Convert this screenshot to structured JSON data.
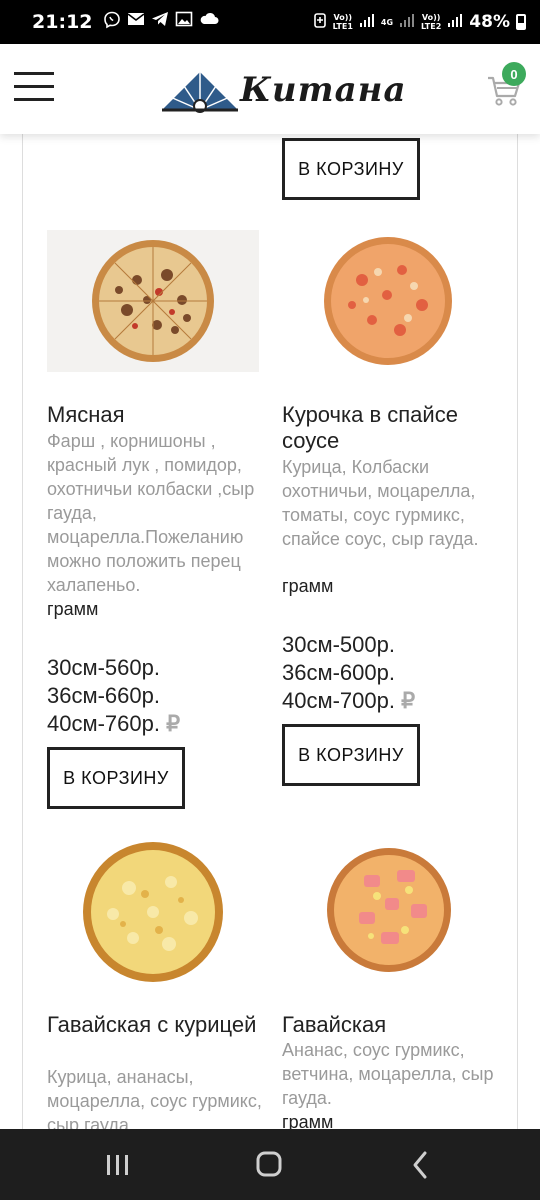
{
  "status": {
    "time": "12",
    "time_h": "21",
    "battery": "48%",
    "sim1_top": "Vo))",
    "sim1_bottom": "LTE1",
    "net": "4G",
    "sim2_top": "Vo))",
    "sim2_bottom": "LTE2",
    "battery_level": 0.48
  },
  "header": {
    "logo_text": "Китана",
    "cart_count": "0"
  },
  "cart_label": "В КОРЗИНУ",
  "products": [
    {
      "name": "Мясная",
      "description": "Фарш , корнишоны , красный лук , помидор, охотничьи колбаски ,сыр гауда, моцарелла.Пожеланию можно положить перец халапеньо.",
      "weight": "грамм",
      "prices": [
        "30см-560р.",
        "36см-660р.",
        "40см-760р."
      ],
      "currency": "₽"
    },
    {
      "name": "Курочка в спайсе соусе",
      "description": "Курица, Колбаски охотничьи, моцарелла, томаты, соус гурмикс, спайсе соус, сыр гауда.",
      "weight": "грамм",
      "prices": [
        "30см-500р.",
        "36см-600р.",
        "40см-700р."
      ],
      "currency": "₽"
    },
    {
      "name": "Гавайская с курицей",
      "description": "Курица, ананасы, моцарелла, соус гурмикс, сыр гауда,"
    },
    {
      "name": "Гавайская",
      "description": "Ананас, соус гурмикс, ветчина, моцарелла, сыр гауда.",
      "weight": "грамм"
    }
  ],
  "colors": {
    "badge": "#3daa5c",
    "logo_blue": "#2f5b8a",
    "desc_gray": "#9a9a9a",
    "nav_bg": "#1e1e1e"
  },
  "icons": [
    "menu-icon",
    "fan-logo-icon",
    "cart-icon",
    "recents-icon",
    "home-icon",
    "back-icon",
    "viber-icon",
    "mail-icon",
    "telegram-icon",
    "gallery-icon",
    "cloud-icon"
  ]
}
